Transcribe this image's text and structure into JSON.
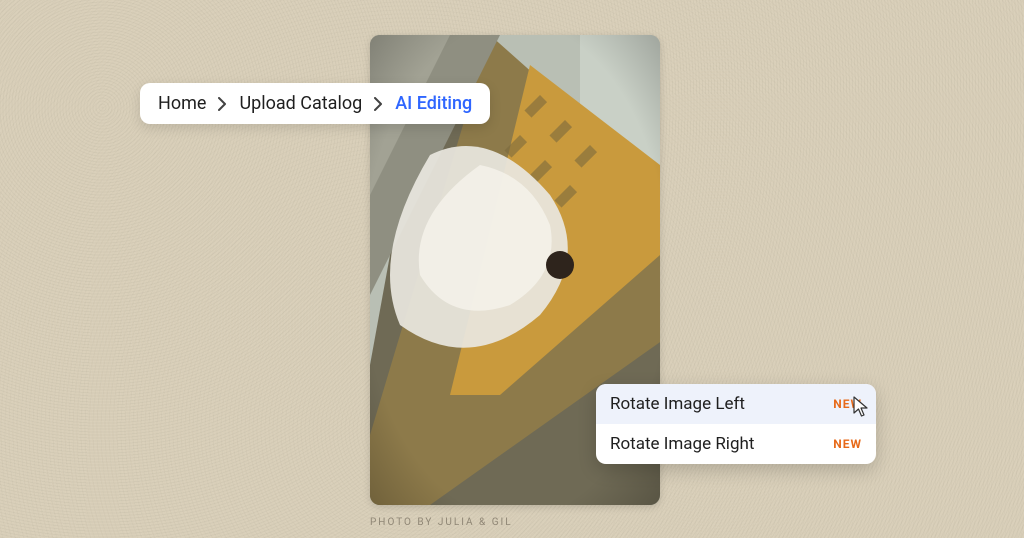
{
  "breadcrumb": {
    "items": [
      {
        "label": "Home"
      },
      {
        "label": "Upload Catalog"
      },
      {
        "label": "AI Editing"
      }
    ]
  },
  "context_menu": {
    "items": [
      {
        "label": "Rotate Image Left",
        "badge": "NEW",
        "hovered": true
      },
      {
        "label": "Rotate Image Right",
        "badge": "NEW",
        "hovered": false
      }
    ]
  },
  "caption": "PHOTO BY JULIA & GIL"
}
